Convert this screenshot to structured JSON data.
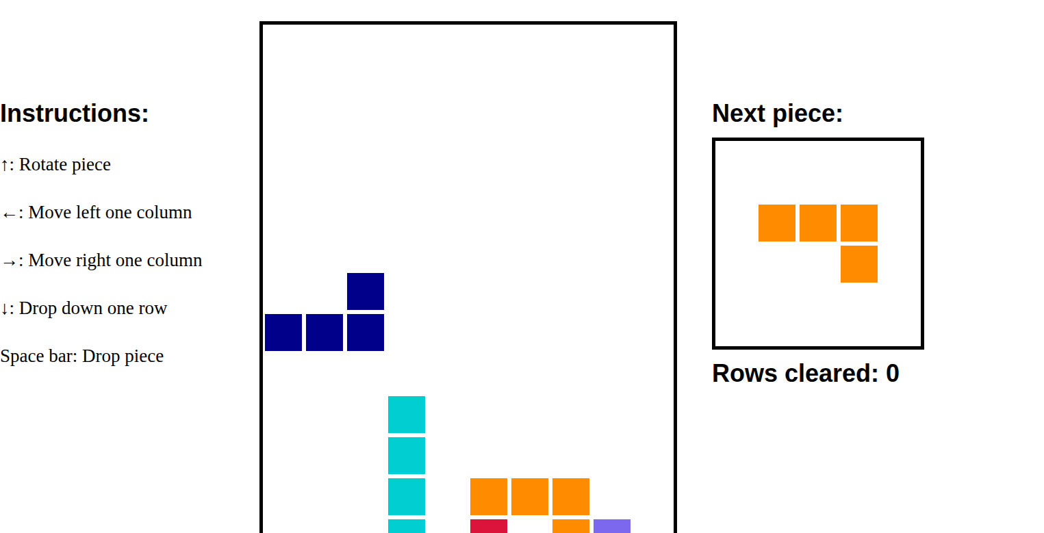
{
  "instructions": {
    "title": "Instructions:",
    "items": [
      "↑: Rotate piece",
      "←: Move left one column",
      "→: Move right one column",
      "↓: Drop down one row",
      "Space bar: Drop piece"
    ]
  },
  "board": {
    "rows": [
      [
        null,
        null,
        null,
        null,
        null,
        null,
        null,
        null,
        null,
        null
      ],
      [
        null,
        null,
        null,
        null,
        null,
        null,
        null,
        null,
        null,
        null
      ],
      [
        null,
        null,
        null,
        null,
        null,
        null,
        null,
        null,
        null,
        null
      ],
      [
        null,
        null,
        null,
        null,
        null,
        null,
        null,
        null,
        null,
        null
      ],
      [
        null,
        null,
        null,
        null,
        null,
        null,
        null,
        null,
        null,
        null
      ],
      [
        null,
        null,
        null,
        null,
        null,
        null,
        null,
        null,
        null,
        null
      ],
      [
        null,
        null,
        "#00008B",
        null,
        null,
        null,
        null,
        null,
        null,
        null
      ],
      [
        "#00008B",
        "#00008B",
        "#00008B",
        null,
        null,
        null,
        null,
        null,
        null,
        null
      ],
      [
        null,
        null,
        null,
        null,
        null,
        null,
        null,
        null,
        null,
        null
      ],
      [
        null,
        null,
        null,
        "#00CED1",
        null,
        null,
        null,
        null,
        null,
        null
      ],
      [
        null,
        null,
        null,
        "#00CED1",
        null,
        null,
        null,
        null,
        null,
        null
      ],
      [
        null,
        null,
        null,
        "#00CED1",
        null,
        "#FF8C00",
        "#FF8C00",
        "#FF8C00",
        null,
        null
      ],
      [
        null,
        null,
        null,
        "#00CED1",
        null,
        "#DC143C",
        null,
        "#FF8C00",
        "#7B68EE",
        null
      ]
    ]
  },
  "next_piece": {
    "title": "Next piece:",
    "rows": [
      [
        "#FF8C00",
        "#FF8C00",
        "#FF8C00"
      ],
      [
        null,
        null,
        "#FF8C00"
      ]
    ]
  },
  "rows_cleared": {
    "label": "Rows cleared:",
    "value": "0"
  }
}
